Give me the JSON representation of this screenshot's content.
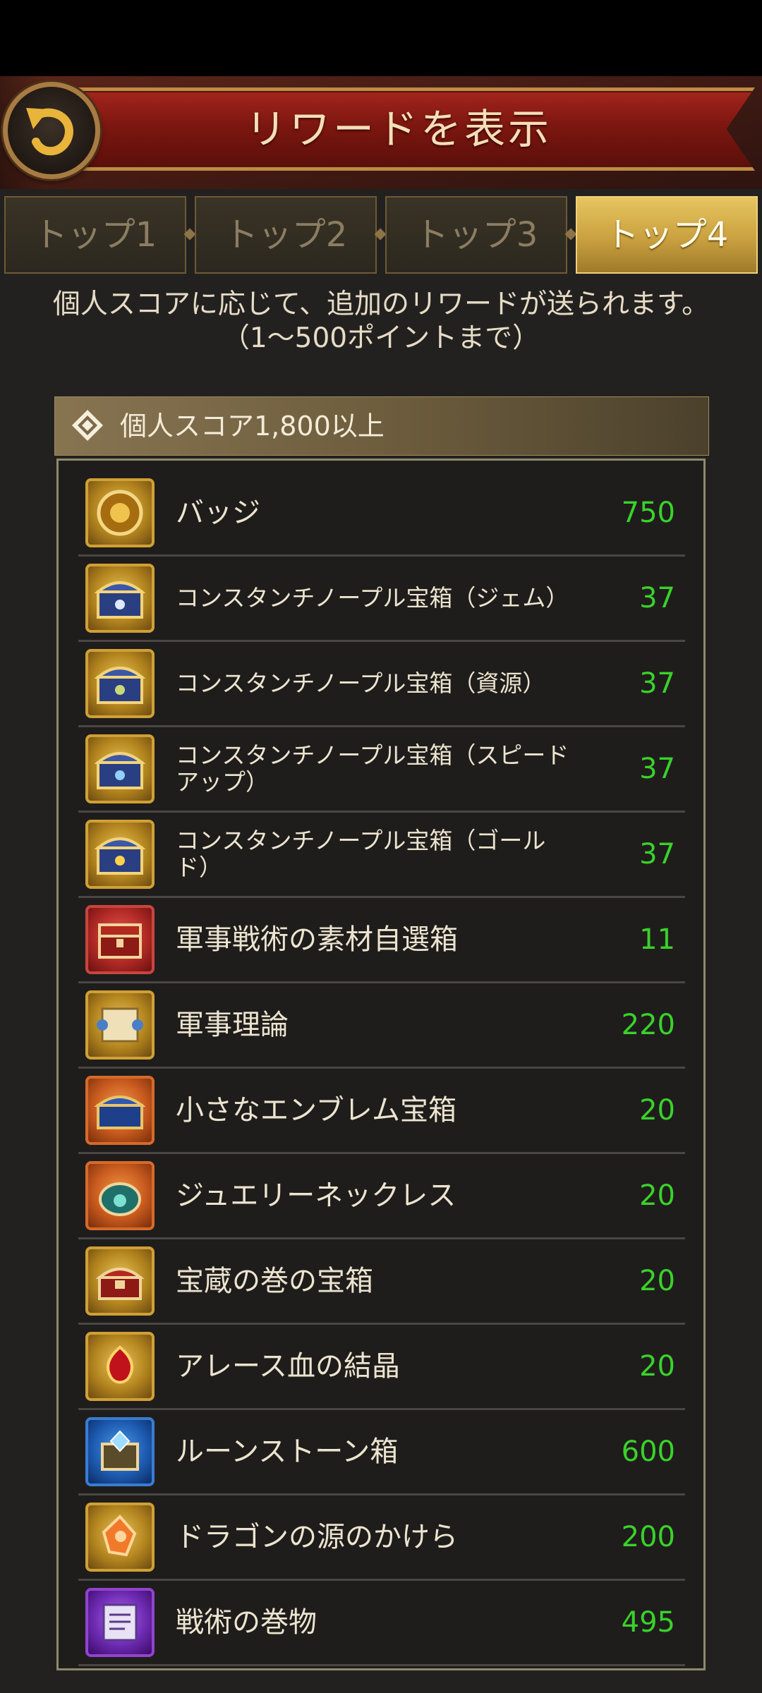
{
  "header": {
    "title": "リワードを表示",
    "back_icon": "back-arrow-icon"
  },
  "tabs": [
    {
      "label": "トップ1",
      "active": false
    },
    {
      "label": "トップ2",
      "active": false
    },
    {
      "label": "トップ3",
      "active": false
    },
    {
      "label": "トップ4",
      "active": true
    }
  ],
  "description": "個人スコアに応じて、追加のリワードが送られます。（1〜500ポイントまで）",
  "section": {
    "title": "個人スコア1,800以上",
    "icon": "diamond-icon"
  },
  "rewards": [
    {
      "name": "バッジ",
      "qty": "750",
      "icon": "badge-icon",
      "frame": "gold"
    },
    {
      "name": "コンスタンチノープル宝箱（ジェム）",
      "qty": "37",
      "icon": "chest-gem-icon",
      "frame": "gold"
    },
    {
      "name": "コンスタンチノープル宝箱（資源）",
      "qty": "37",
      "icon": "chest-resource-icon",
      "frame": "gold"
    },
    {
      "name": "コンスタンチノープル宝箱（スピードアップ）",
      "qty": "37",
      "icon": "chest-speedup-icon",
      "frame": "gold"
    },
    {
      "name": "コンスタンチノープル宝箱（ゴールド）",
      "qty": "37",
      "icon": "chest-gold-icon",
      "frame": "gold"
    },
    {
      "name": "軍事戦術の素材自選箱",
      "qty": "11",
      "icon": "red-chest-icon",
      "frame": "red"
    },
    {
      "name": "軍事理論",
      "qty": "220",
      "icon": "scroll-icon",
      "frame": "gold"
    },
    {
      "name": "小さなエンブレム宝箱",
      "qty": "20",
      "icon": "emblem-chest-icon",
      "frame": "orange"
    },
    {
      "name": "ジュエリーネックレス",
      "qty": "20",
      "icon": "necklace-icon",
      "frame": "orange"
    },
    {
      "name": "宝蔵の巻の宝箱",
      "qty": "20",
      "icon": "treasure-chest-icon",
      "frame": "gold"
    },
    {
      "name": "アレース血の結晶",
      "qty": "20",
      "icon": "blood-crystal-icon",
      "frame": "gold"
    },
    {
      "name": "ルーンストーン箱",
      "qty": "600",
      "icon": "runestone-box-icon",
      "frame": "blue"
    },
    {
      "name": "ドラゴンの源のかけら",
      "qty": "200",
      "icon": "dragon-shard-icon",
      "frame": "gold"
    },
    {
      "name": "戦術の巻物",
      "qty": "495",
      "icon": "tactics-scroll-icon",
      "frame": "purple"
    }
  ]
}
